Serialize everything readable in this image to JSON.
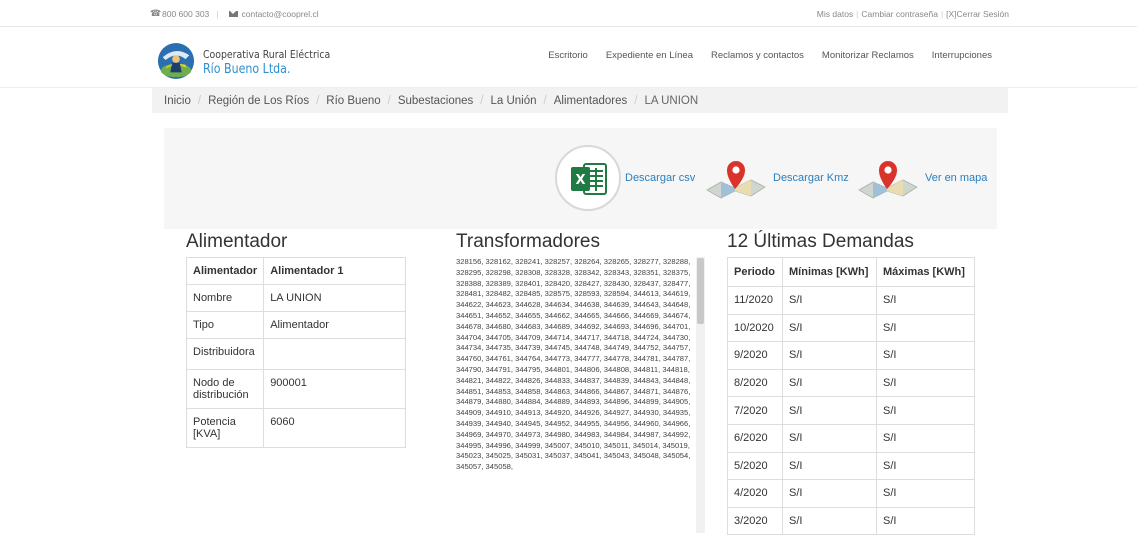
{
  "topbar": {
    "phone": "800 600 303",
    "email": "contacto@cooprel.cl",
    "links": [
      "Mis datos",
      "Cambiar contraseña",
      "[X]Cerrar Sesión"
    ]
  },
  "brand": {
    "line1": "Cooperativa Rural Eléctrica",
    "line2": "Río Bueno Ltda.",
    "color": "#2d8fd0"
  },
  "nav": [
    "Escritorio",
    "Expediente en Línea",
    "Reclamos y contactos",
    "Monitorizar Reclamos",
    "Interrupciones"
  ],
  "breadcrumb": [
    "Inicio",
    "Región de Los Ríos",
    "Río Bueno",
    "Subestaciones",
    "La Unión",
    "Alimentadores",
    "LA UNION"
  ],
  "downloads": {
    "csv": "Descargar csv",
    "kmz": "Descargar Kmz",
    "map": "Ver en mapa",
    "excel_color": "#1f7a43",
    "pin_color": "#d9342b",
    "link_color": "#2a7fbf"
  },
  "alimentador": {
    "title": "Alimentador",
    "header": [
      "Alimentador",
      "Alimentador 1"
    ],
    "rows": [
      [
        "Nombre",
        "LA UNION"
      ],
      [
        "Tipo",
        "Alimentador"
      ],
      [
        "Distribuidora",
        ""
      ],
      [
        "Nodo de distribución",
        "900001"
      ],
      [
        "Potencia [KVA]",
        "6060"
      ]
    ]
  },
  "transformadores": {
    "title": "Transformadores",
    "list": "328156, 328162, 328241, 328257, 328264, 328265, 328277, 328288, 328295, 328298, 328308, 328328, 328342, 328343, 328351, 328375, 328388, 328389, 328401, 328420, 328427, 328430, 328437, 328477, 328481, 328482, 328485, 328575, 328593, 328594, 344613, 344619, 344622, 344623, 344628, 344634, 344638, 344639, 344643, 344648, 344651, 344652, 344655, 344662, 344665, 344666, 344669, 344674, 344678, 344680, 344683, 344689, 344692, 344693, 344696, 344701, 344704, 344705, 344709, 344714, 344717, 344718, 344724, 344730, 344734, 344735, 344739, 344745, 344748, 344749, 344752, 344757, 344760, 344761, 344764, 344773, 344777, 344778, 344781, 344787, 344790, 344791, 344795, 344801, 344806, 344808, 344811, 344818, 344821, 344822, 344826, 344833, 344837, 344839, 344843, 344848, 344851, 344853, 344858, 344863, 344866, 344867, 344871, 344876, 344879, 344880, 344884, 344889, 344893, 344896, 344899, 344905, 344909, 344910, 344913, 344920, 344926, 344927, 344930, 344935, 344939, 344940, 344945, 344952, 344955, 344956, 344960, 344966, 344969, 344970, 344973, 344980, 344983, 344984, 344987, 344992, 344995, 344996, 344999, 345007, 345010, 345011, 345014, 345019, 345023, 345025, 345031, 345037, 345041, 345043, 345048, 345054, 345057, 345058,"
  },
  "demandas": {
    "title": "12 Últimas Demandas",
    "headers": [
      "Periodo",
      "Mínimas [KWh]",
      "Máximas [KWh]"
    ],
    "rows": [
      [
        "11/2020",
        "S/I",
        "S/I"
      ],
      [
        "10/2020",
        "S/I",
        "S/I"
      ],
      [
        "9/2020",
        "S/I",
        "S/I"
      ],
      [
        "8/2020",
        "S/I",
        "S/I"
      ],
      [
        "7/2020",
        "S/I",
        "S/I"
      ],
      [
        "6/2020",
        "S/I",
        "S/I"
      ],
      [
        "5/2020",
        "S/I",
        "S/I"
      ],
      [
        "4/2020",
        "S/I",
        "S/I"
      ],
      [
        "3/2020",
        "S/I",
        "S/I"
      ]
    ]
  }
}
